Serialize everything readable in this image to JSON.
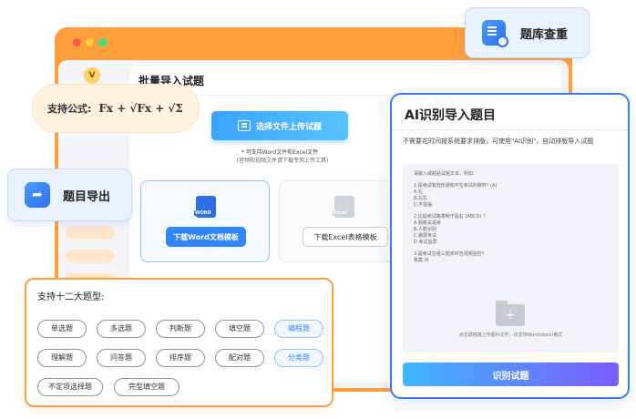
{
  "main_window": {
    "page_title": "批量导入试题",
    "upload_button": "选择文件上传试题",
    "upload_note": "* 可支持Word文件和Excel文件",
    "upload_note2": "(音频和视频文件请下载专用上传工具)",
    "word_template": {
      "icon_text": "WORD",
      "button": "下载Word文档模板"
    },
    "excel_template": {
      "icon_text": "Excel",
      "button": "下载Excel表格模板"
    },
    "logo": "V"
  },
  "formula_bubble": {
    "label": "支持公式:",
    "expression": "Fx + √Fx + √Σ"
  },
  "export_bubble": {
    "label": "题目导出",
    "icon": "share-icon"
  },
  "dup_bubble": {
    "label": "题库查重",
    "icon": "search-doc-icon"
  },
  "ai_panel": {
    "title": "AI识别导入题目",
    "description": "不需要花时间按系统要求排版，可使用\"AI识别\"，自动排版导入试题",
    "sample_lines": [
      "请输入或粘贴试题文本，例如:",
      "",
      "1.提考试有险伤通知不生考试的碳时? (A)",
      "A.右",
      "B.左右",
      "C.不能盖",
      "",
      "2.比提考试路香畅于提右 (ABCD) ?",
      "A.题撤关毫考",
      "B.人脸识别",
      "C.避屏考试",
      "D.考试监屏",
      "",
      "3.提考试在组三题实时告视频监控?",
      "答案:对"
    ],
    "upload_hint": "点击或拖拽上传图片文件，仅支持Word(docx)格式",
    "recognize_button": "识别试题"
  },
  "types_panel": {
    "title": "支持十二大题型:",
    "tags": [
      "单选题",
      "多选题",
      "判断题",
      "填空题",
      "编程题",
      "理解题",
      "问答题",
      "排序题",
      "配对题",
      "分类题",
      "不定项选择题",
      "完型填空题"
    ]
  }
}
